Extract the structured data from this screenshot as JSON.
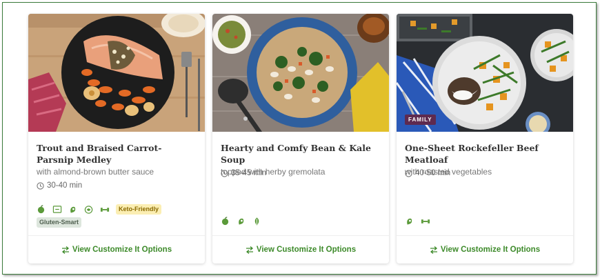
{
  "cards": [
    {
      "title": "Trout and Braised Carrot-Parsnip Medley",
      "subtitle": "with almond-brown butter sauce",
      "time": "30-40 min",
      "icons": [
        "apple-icon",
        "calories-icon",
        "protein-icon",
        "low-carb-icon",
        "dumbbell-icon"
      ],
      "tags": [
        "Keto-Friendly",
        "Gluten-Smart"
      ],
      "cta": "View Customize It Options"
    },
    {
      "title": "Hearty and Comfy Bean & Kale Soup",
      "subtitle": "topped with herby gremolata",
      "time": "35-45 min",
      "icons": [
        "apple-icon",
        "protein-icon",
        "leaf-icon"
      ],
      "tags": [],
      "cta": "View Customize It Options"
    },
    {
      "title": "One-Sheet Rockefeller Beef Meatloaf",
      "subtitle": "with roasted vegetables",
      "time": "40-50 min",
      "badge": "FAMILY",
      "icons": [
        "protein-icon",
        "dumbbell-icon"
      ],
      "tags": [],
      "cta": "View Customize It Options"
    }
  ],
  "colors": {
    "accent_green": "#3d8a2a",
    "keto_bg": "#fbeeb3",
    "gluten_bg": "#dde6dd",
    "family_badge": "#5e2a4f"
  }
}
